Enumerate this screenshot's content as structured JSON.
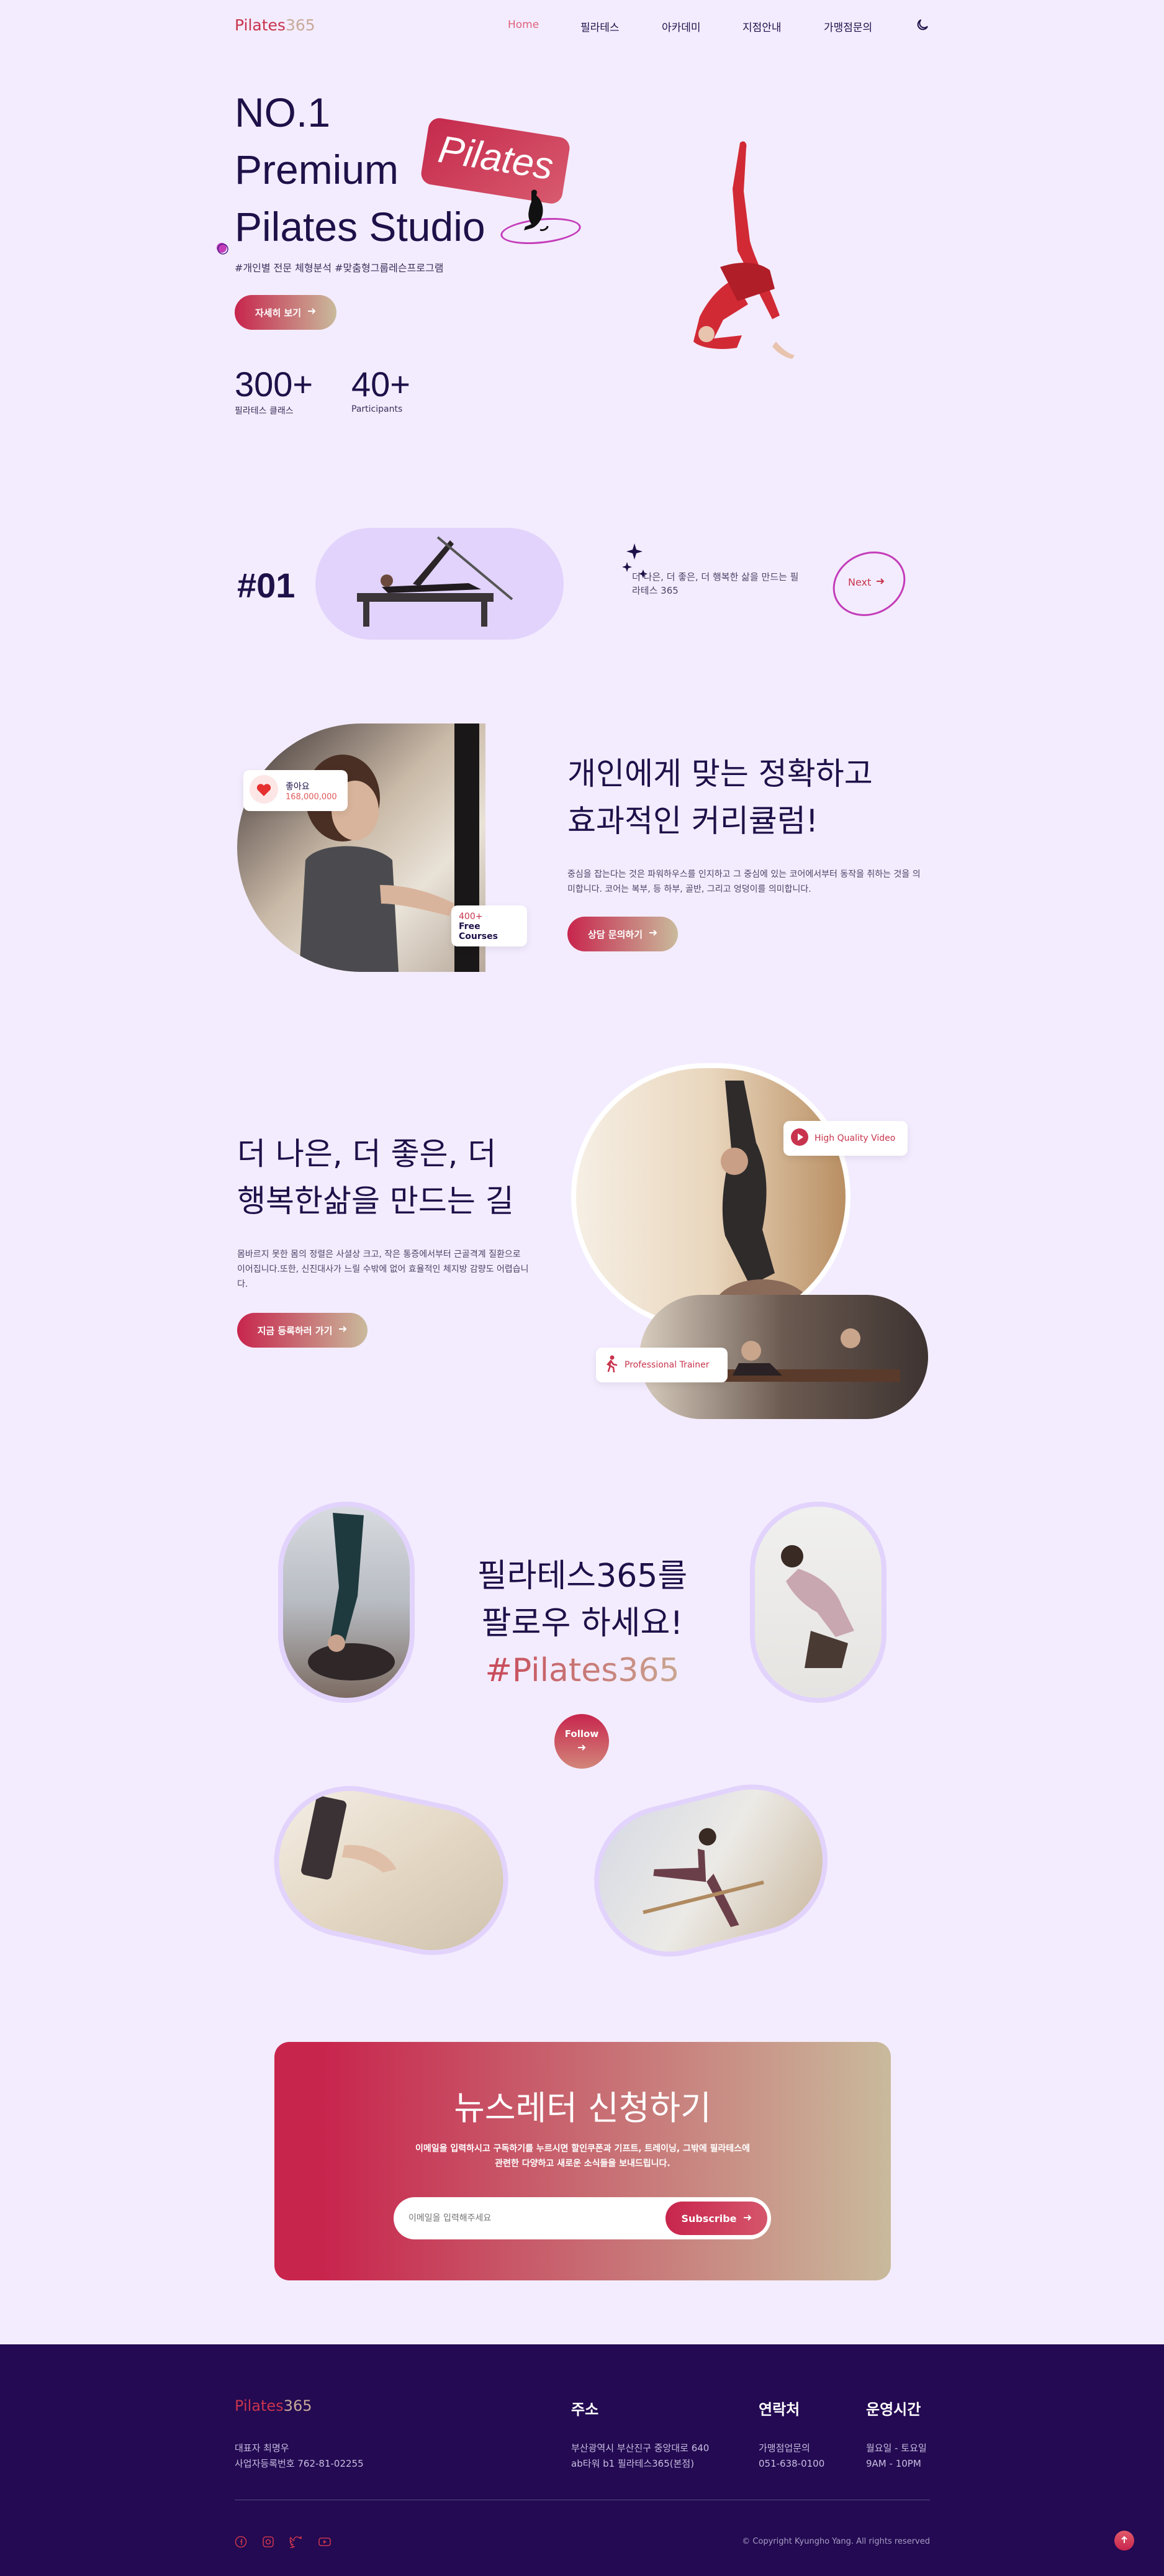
{
  "nav": {
    "logo_main": "Pilates",
    "logo_num": "365",
    "items": [
      "Home",
      "필라테스",
      "아카데미",
      "지점안내",
      "가맹점문의"
    ]
  },
  "hero": {
    "title_lines": [
      "NO.1",
      "Premium",
      "Pilates Studio"
    ],
    "tag": "Pilates",
    "hashtags": "#개인별 전문 체형분석 #맞춤형그룹레슨프로그램",
    "button": "자세히 보기",
    "stats": [
      {
        "num": "300+",
        "label": "필라테스 클래스"
      },
      {
        "num": "40+",
        "label": "Participants"
      }
    ]
  },
  "section01": {
    "number": "#01",
    "text": "더 나은, 더 좋은, 더 행복한 삶을 만드는 필라테스 365",
    "next": "Next"
  },
  "curriculum": {
    "like_label": "좋아요",
    "like_count": "168,000,000",
    "courses_count": "400+",
    "courses_label": "Free Courses",
    "title_line1": "개인에게 맞는 정확하고",
    "title_line2": "효과적인 커리큘럼!",
    "desc": "중심을 잡는다는 것은 파워하우스를 인지하고 그 중심에 있는 코어에서부터 동작을 취하는 것을 의미합니다. 코어는 복부, 등 하부, 골반, 그리고 엉덩이를 의미합니다.",
    "button": "상담 문의하기"
  },
  "better": {
    "title_line1": "더 나은, 더 좋은, 더",
    "title_line2": "행복한삶을 만드는 길",
    "desc": "몸바르지 못한 몸의 정렬은 사셜상 크고, 작은 통증에서부터 근골격계 질환으로 이어집니다.또한, 신진대사가 느릴 수밖에 없어 효율적인 체지방 감량도 어렵습니다.",
    "button": "지금 등록하러 가기",
    "badge_video": "High Quality Video",
    "badge_trainer": "Professional Trainer"
  },
  "follow": {
    "line1": "필라테스365를",
    "line2": "팔로우 하세요!",
    "hashtag": "#Pilates365",
    "button": "Follow"
  },
  "newsletter": {
    "title": "뉴스레터 신청하기",
    "desc_line1": "이메일을 입력하시고 구독하기를 누르시면 할인쿠폰과 기프트, 트레이닝, 그밖에 필라테스에",
    "desc_line2": "관련한 다양하고 새로운 소식들을 보내드립니다.",
    "placeholder": "이메일을 입력해주세요",
    "button": "Subscribe"
  },
  "footer": {
    "logo_main": "Pilates",
    "logo_num": "365",
    "ceo": "대표자 최명우",
    "biz": "사업자등록번호 762-81-02255",
    "address_title": "주소",
    "address_line1": "부산광역시 부산진구 중앙대로 640",
    "address_line2": "ab타워 b1 필라테스365(본점)",
    "contact_title": "연락처",
    "contact_line1": "가맹점업문의",
    "contact_line2": "051-638-0100",
    "hours_title": "운영시간",
    "hours_line1": "월요일 - 토요일",
    "hours_line2": "9AM - 10PM",
    "copyright": "© Copyright Kyungho Yang. All rights reserved"
  },
  "colors": {
    "brand": "#c8254d",
    "accent_gold": "#c9ba9c",
    "navy": "#1e1149",
    "bg": "#f3ecfe",
    "footer_bg": "#230a52"
  },
  "icons": [
    "moon-icon",
    "arrow-right-icon",
    "heart-icon",
    "sparkle-icon",
    "play-icon",
    "runner-icon",
    "facebook-icon",
    "instagram-icon",
    "twitter-icon",
    "youtube-icon",
    "arrow-up-icon"
  ]
}
